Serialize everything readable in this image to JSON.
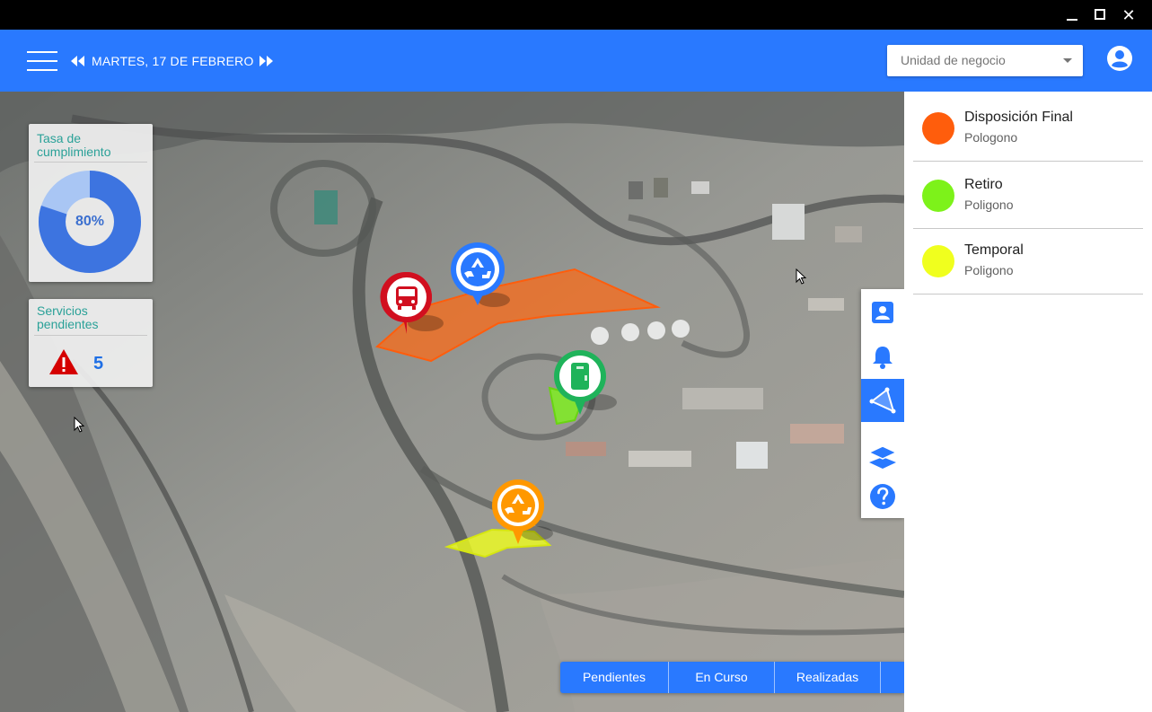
{
  "window": {
    "controls": [
      "minimize",
      "maximize",
      "close"
    ],
    "close_glyph": "✕"
  },
  "header": {
    "date": "MARTES, 17 DE FEBRERO",
    "business_unit": {
      "placeholder": "Unidad de negocio"
    }
  },
  "kpis": {
    "compliance": {
      "title": "Tasa de cumplimiento",
      "percent": 80,
      "label": "80%"
    },
    "pending": {
      "title": "Servicios pendientes",
      "count": "5"
    }
  },
  "legend": [
    {
      "name": "Disposición Final",
      "type": "Pologono",
      "color": "#ff5d0c"
    },
    {
      "name": "Retiro",
      "type": "Poligono",
      "color": "#7df21a"
    },
    {
      "name": "Temporal",
      "type": "Poligono",
      "color": "#f0ff1e"
    }
  ],
  "map": {
    "markers": [
      {
        "icon": "bus-icon",
        "color": "#d10f1f"
      },
      {
        "icon": "recycle-icon",
        "color": "#2979ff"
      },
      {
        "icon": "container-icon",
        "color": "#1fb35a"
      },
      {
        "icon": "recycle-icon",
        "color": "#ff9800"
      }
    ],
    "tools": [
      "contact-icon",
      "bell-icon",
      "polygon-icon",
      "layers-icon",
      "help-icon"
    ]
  },
  "tabs": [
    "Pendientes",
    "En Curso",
    "Realizadas",
    ""
  ],
  "colors": {
    "accent": "#2979ff",
    "titlebar": "#000000",
    "kpi_title": "#2aa198",
    "warning": "#d50000"
  }
}
